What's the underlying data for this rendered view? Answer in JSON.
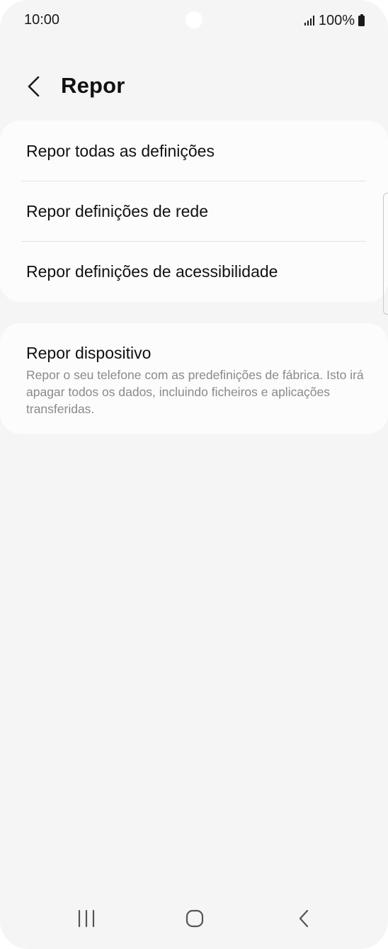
{
  "status_bar": {
    "time": "10:00",
    "battery_text": "100%",
    "icons": [
      "signal-icon",
      "battery-icon"
    ]
  },
  "header": {
    "title": "Repor",
    "back_icon": "chevron-left-icon"
  },
  "reset_options": [
    {
      "label": "Repor todas as definições"
    },
    {
      "label": "Repor definições de rede"
    },
    {
      "label": "Repor definições de acessibilidade"
    }
  ],
  "device_reset": {
    "title": "Repor dispositivo",
    "description": "Repor o seu telefone com as predefinições de fábrica. Isto irá apagar todos os dados, incluindo ficheiros e aplicações transferidas."
  },
  "navigation_bar": {
    "icons": [
      "recent-apps-icon",
      "home-icon",
      "back-icon"
    ]
  },
  "colors": {
    "background": "#f5f5f5",
    "card": "#fcfcfc",
    "primary_text": "#111111",
    "secondary_text": "#8a8a8a",
    "divider": "#e3e3e3"
  }
}
